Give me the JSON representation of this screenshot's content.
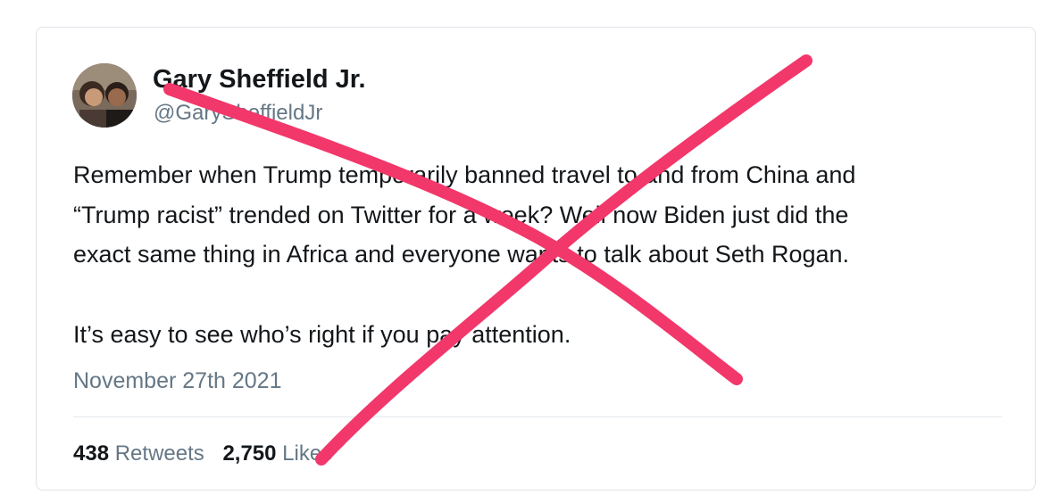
{
  "tweet": {
    "display_name": "Gary Sheffield Jr.",
    "handle": "@GarySheffieldJr",
    "lines": [
      "Remember when Trump temporarily banned travel to and from China and",
      "“Trump racist” trended on Twitter for a week? Well now Biden just did the",
      "exact same thing in Africa and everyone wants to talk about Seth Rogan.",
      "It’s easy to see who’s right if you pay attention."
    ],
    "timestamp": "November 27th 2021",
    "retweets_count": "438",
    "retweets_label": "Retweets",
    "likes_count": "2,750",
    "likes_label": "Likes"
  },
  "overlay": {
    "mark": "x-cross-out",
    "color": "#f2376a"
  }
}
